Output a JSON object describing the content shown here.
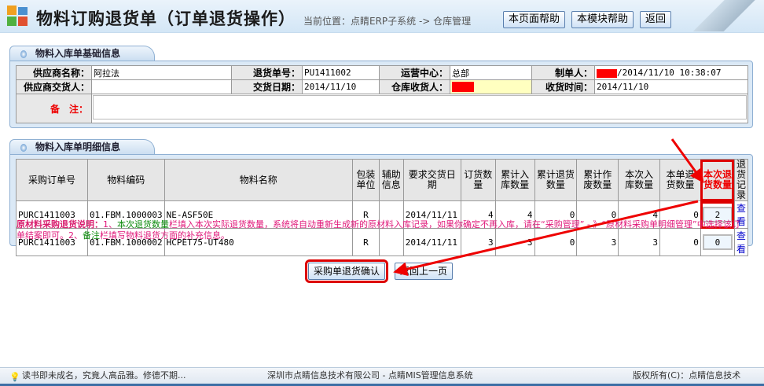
{
  "header": {
    "title": "物料订购退货单（订单退货操作）",
    "breadcrumb": "当前位置：点睛ERP子系统 -> 仓库管理",
    "buttons": [
      "本页面帮助",
      "本模块帮助",
      "返回"
    ]
  },
  "basic": {
    "tab": "物料入库单基础信息",
    "supplier_label": "供应商名称：",
    "supplier": "阿拉法",
    "return_no_label": "退货单号：",
    "return_no": "PU1411002",
    "center_label": "运营中心：",
    "center": "总部",
    "maker_label": "制单人：",
    "maker_time": "/2014/11/10 10:38:07",
    "deliverer_label": "供应商交货人：",
    "deliverer": "",
    "delivery_date_label": "交货日期：",
    "delivery_date": "2014/11/10",
    "receiver_label": "仓库收货人：",
    "receive_time_label": "收货时间：",
    "receive_time": "2014/11/10",
    "remark_label": "备　注：",
    "remark": ""
  },
  "detail": {
    "tab": "物料入库单明细信息",
    "columns": [
      "采购订单号",
      "物料编码",
      "物料名称",
      "包装单位",
      "辅助信息",
      "要求交货日期",
      "订货数量",
      "累计入库数量",
      "累计退货数量",
      "累计作废数量",
      "本次入库数量",
      "本单退货数量",
      "本次退货数量",
      "退货记录"
    ],
    "rows": [
      {
        "order": "PURC1411003",
        "code": "01.FBM.1000003",
        "name": "NE-ASF50E",
        "unit": "R",
        "aux": "",
        "date": "2014/11/11",
        "ordered": "4",
        "in_total": "4",
        "ret_total": "0",
        "void_total": "0",
        "in_now": "4",
        "ret_bill": "0",
        "ret_now": "2",
        "link": "查看"
      },
      {
        "order": "PURC1411003",
        "code": "01.FBM.1000002",
        "name": "HCPET75-UT480",
        "unit": "R",
        "aux": "",
        "date": "2014/11/11",
        "ordered": "3",
        "in_total": "3",
        "ret_total": "0",
        "void_total": "3",
        "in_now": "3",
        "ret_bill": "0",
        "ret_now": "0",
        "link": "查看"
      }
    ],
    "note_title": "原材料采购退货说明：",
    "note_1": "1、",
    "note_g1": "本次退货数量",
    "note_2": "栏填入本次实际退货数量，系统将自动重新生成新的原材料入库记录，如果你确定不再入库，请在“采购管理” - 》“原材料采购单明细管理”中选择该订单结案即可。2、",
    "note_g2": "备注",
    "note_3": "栏填写物料退货方面的补充信息。"
  },
  "actions": {
    "confirm": "采购单退货确认",
    "back": "返回上一页"
  },
  "footer": {
    "quote": "读书即未成名，究竟人高品雅。修德不期...",
    "company": "深圳市点睛信息技术有限公司 - 点睛MIS管理信息系统",
    "copyright": "版权所有(C)：点睛信息技术"
  }
}
